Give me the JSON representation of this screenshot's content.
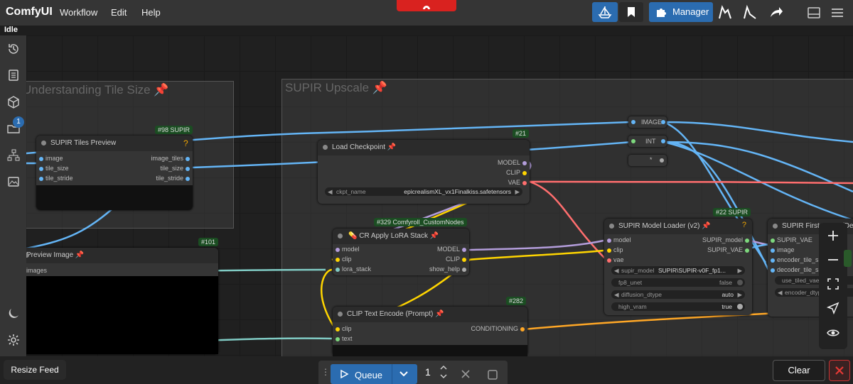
{
  "app": {
    "brand": "ComfyUI",
    "status": "Idle"
  },
  "menu": [
    {
      "label": "Workflow"
    },
    {
      "label": "Edit"
    },
    {
      "label": "Help"
    }
  ],
  "toolbar": {
    "manager_label": "Manager"
  },
  "sidebar": {
    "queue_badge": "1"
  },
  "groups": [
    {
      "title": "Understanding Tile Size"
    },
    {
      "title": "SUPIR Upscale"
    }
  ],
  "nodes": {
    "tiles_preview": {
      "title": "SUPIR Tiles Preview",
      "badge": "#98 SUPIR",
      "inputs": [
        "image",
        "tile_size",
        "tile_stride"
      ],
      "outputs": [
        "image_tiles",
        "tile_size",
        "tile_stride"
      ]
    },
    "load_checkpoint": {
      "title": "Load Checkpoint",
      "badge": "#21",
      "outputs": [
        "MODEL",
        "CLIP",
        "VAE"
      ],
      "widget_label": "ckpt_name",
      "widget_value": "epicrealismXL_vx1Finalkiss.safetensors"
    },
    "preview_image": {
      "title": "Preview Image",
      "badge": "#101",
      "inputs": [
        "images"
      ]
    },
    "lora_stack": {
      "title": "CR Apply LoRA Stack",
      "badge": "#329 Comfyroll_CustomNodes",
      "inputs": [
        "model",
        "clip",
        "lora_stack"
      ],
      "outputs": [
        "MODEL",
        "CLIP",
        "show_help"
      ]
    },
    "clip_text": {
      "title": "CLIP Text Encode (Prompt)",
      "badge": "#282",
      "inputs": [
        "clip",
        "text"
      ],
      "outputs": [
        "CONDITIONING"
      ]
    },
    "supir_loader": {
      "title": "SUPIR Model Loader (v2)",
      "badge": "#22 SUPIR",
      "inputs": [
        "model",
        "clip",
        "vae"
      ],
      "outputs": [
        "SUPIR_model",
        "SUPIR_VAE"
      ],
      "widgets": [
        {
          "label": "supir_model",
          "value": "SUPIR\\SUPIR-v0F_fp1..."
        },
        {
          "label": "fp8_unet",
          "value": "false"
        },
        {
          "label": "diffusion_dtype",
          "value": "auto"
        },
        {
          "label": "high_vram",
          "value": "true"
        }
      ]
    },
    "supir_first": {
      "title": "SUPIR First Stage (Denoiser)",
      "inputs": [
        "SUPIR_VAE",
        "image",
        "encoder_tile_size",
        "decoder_tile_size"
      ],
      "widgets": [
        {
          "label": "use_tiled_vae"
        },
        {
          "label": "encoder_dtype"
        }
      ]
    },
    "reroutes": [
      {
        "label": "IMAGE"
      },
      {
        "label": "INT"
      },
      {
        "label": "*"
      }
    ]
  },
  "queue": {
    "label": "Queue",
    "count": "1"
  },
  "footer": {
    "resize_label": "Resize Feed",
    "clear_label": "Clear"
  },
  "colors": {
    "accent": "#2b6cb0",
    "red": "#d9221f",
    "model_wire": "#b39ddb",
    "clip_wire": "#ffd500",
    "vae_wire": "#ff6e6e",
    "image_wire": "#64b5f6",
    "latent_wire": "#ff9cf9"
  }
}
